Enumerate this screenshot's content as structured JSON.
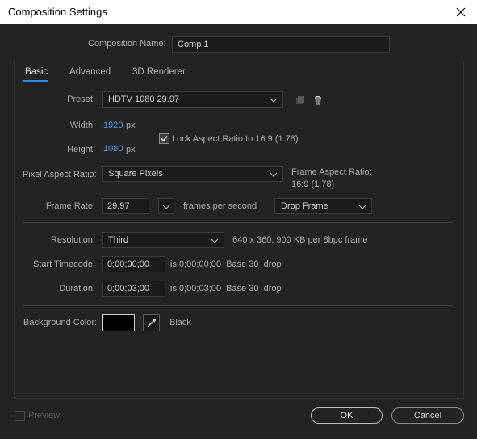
{
  "window": {
    "title": "Composition Settings"
  },
  "comp_name": {
    "label": "Composition Name:",
    "value": "Comp 1"
  },
  "tabs": [
    {
      "label": "Basic",
      "active": true
    },
    {
      "label": "Advanced",
      "active": false
    },
    {
      "label": "3D Renderer",
      "active": false
    }
  ],
  "preset": {
    "label": "Preset:",
    "value": "HDTV 1080 29.97"
  },
  "width": {
    "label": "Width:",
    "value": "1920",
    "unit": "px"
  },
  "height": {
    "label": "Height:",
    "value": "1080",
    "unit": "px"
  },
  "lock_aspect": {
    "label": "Lock Aspect Ratio to 16:9 (1.78)",
    "checked": true
  },
  "pixel_aspect": {
    "label": "Pixel Aspect Ratio:",
    "value": "Square Pixels"
  },
  "frame_aspect": {
    "label": "Frame Aspect Ratio:",
    "value": "16:9 (1.78)"
  },
  "frame_rate": {
    "label": "Frame Rate:",
    "value": "29.97",
    "unit": "frames per second",
    "drop_mode": "Drop Frame"
  },
  "resolution": {
    "label": "Resolution:",
    "value": "Third",
    "info": "640 x 360, 900 KB per 8bpc frame"
  },
  "start_timecode": {
    "label": "Start Timecode:",
    "value": "0;00;00;00",
    "info": "is 0;00;00;00  Base 30  drop"
  },
  "duration": {
    "label": "Duration:",
    "value": "0;00;03;00",
    "info": "is 0;00;03;00  Base 30  drop"
  },
  "background": {
    "label": "Background Color:",
    "color_name": "Black",
    "color": "#000000"
  },
  "footer": {
    "preview_label": "Preview",
    "ok_label": "OK",
    "cancel_label": "Cancel"
  },
  "colors": {
    "accent": "#2d8ceb",
    "value_blue": "#4a9ae8"
  }
}
